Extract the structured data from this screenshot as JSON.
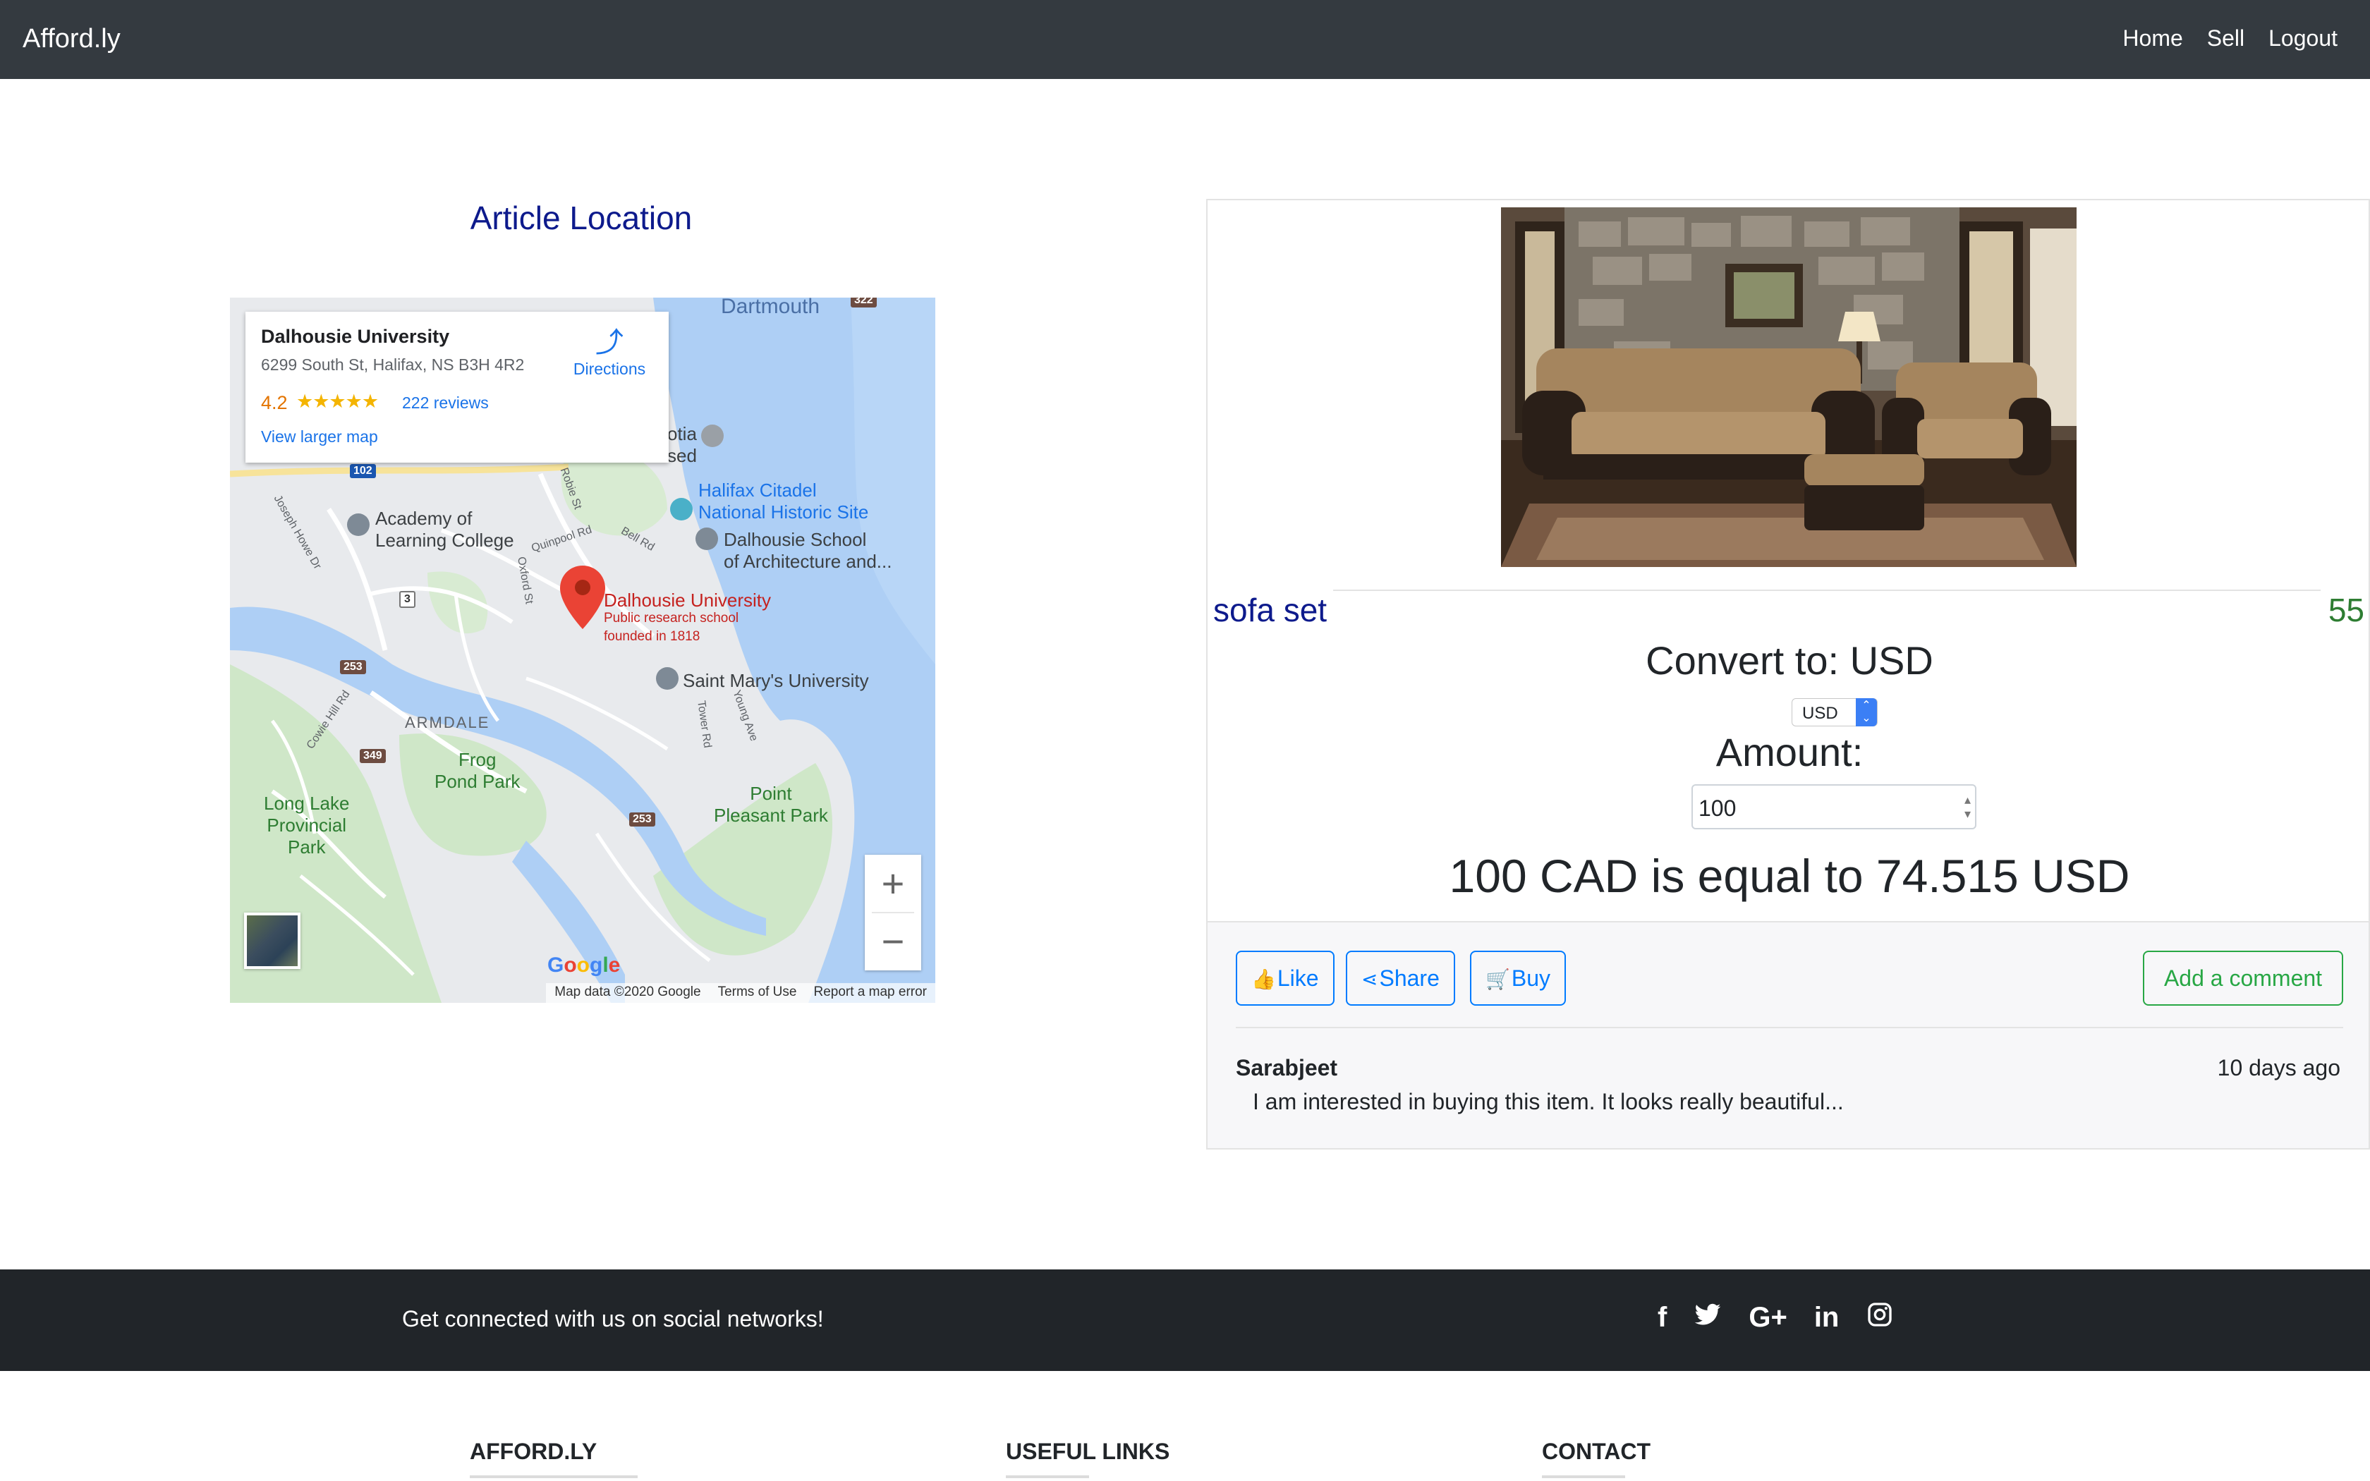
{
  "navbar": {
    "brand": "Afford.ly",
    "links": [
      "Home",
      "Sell",
      "Logout"
    ]
  },
  "map_section": {
    "title": "Article Location",
    "info_card": {
      "name": "Dalhousie University",
      "address": "6299 South St, Halifax, NS B3H 4R2",
      "rating": "4.2",
      "stars": "★★★★★",
      "reviews": "222 reviews",
      "larger_map": "View larger map",
      "directions": "Directions"
    },
    "labels": {
      "dartmouth": "Dartmouth",
      "citadel": "Halifax Citadel\nNational Historic Site",
      "citadel_1": "Halifax Citadel",
      "citadel_2": "National Historic Site",
      "academy_1": "Academy of",
      "academy_2": "Learning College",
      "arch_1": "Dalhousie School",
      "arch_2": "of Architecture and...",
      "dal_1": "Dalhousie University",
      "dal_2": "Public research school",
      "dal_3": "founded in 1818",
      "saint_marys": "Saint Mary's University",
      "armdale": "ARMDALE",
      "frog_1": "Frog",
      "frog_2": "Pond Park",
      "point_1": "Point",
      "point_2": "Pleasant Park",
      "long_1": "Long Lake",
      "long_2": "Provincial",
      "long_3": "Park",
      "otia": "otia",
      "sed": "sed",
      "robie": "Robie St",
      "quinpool": "Quinpool Rd",
      "bell": "Bell Rd",
      "oxford": "Oxford St",
      "young": "Young Ave",
      "tower": "Tower Rd",
      "cowie": "Cowie Hill Rd",
      "joseph": "Joseph Howe Dr",
      "r102": "102",
      "r3": "3",
      "r253": "253",
      "r349": "349",
      "r322": "322"
    },
    "google_logo": "Google",
    "footer": [
      "Map data ©2020 Google",
      "Terms of Use",
      "Report a map error"
    ],
    "zoom_in": "+",
    "zoom_out": "−"
  },
  "product": {
    "title": "sofa set",
    "price": "55",
    "convert_label": "Convert to: USD",
    "currency_selected": "USD",
    "amount_label": "Amount:",
    "amount_value": "100",
    "result": "100 CAD is equal to 74.515 USD"
  },
  "actions": {
    "like": "Like",
    "share": "Share",
    "buy": "Buy",
    "add_comment": "Add a comment"
  },
  "comment": {
    "author": "Sarabjeet",
    "time": "10 days ago",
    "text": "I am interested in buying this item. It looks really beautiful..."
  },
  "footer": {
    "social_text": "Get connected with us on social networks!",
    "social_icons": [
      "f",
      "t",
      "G+",
      "in",
      "ig"
    ],
    "columns": [
      "AFFORD.LY",
      "USEFUL LINKS",
      "CONTACT"
    ]
  },
  "colors": {
    "navbar_bg": "#343a40",
    "title_blue": "#0d1a8c",
    "price_green": "#2e7d32",
    "primary": "#007bff",
    "success": "#28a745",
    "footer_bg": "#212529"
  }
}
